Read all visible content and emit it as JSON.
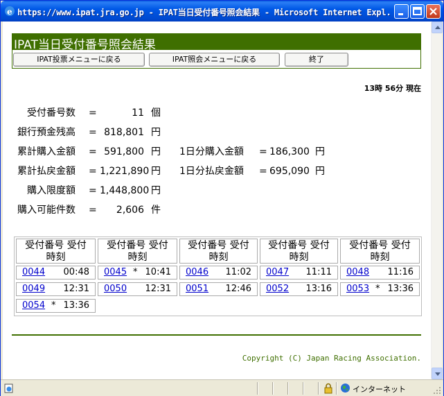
{
  "window": {
    "title": "https://www.ipat.jra.go.jp - IPAT当日受付番号照会結果 - Microsoft Internet Expl..."
  },
  "page": {
    "title": "IPAT当日受付番号照会結果",
    "nav": {
      "vote_menu": "IPAT投票メニューに戻る",
      "inquiry_menu": "IPAT照会メニューに戻る",
      "exit": "終了"
    },
    "current_time": "13時 56分 現在",
    "summary": [
      {
        "label": "受付番号数",
        "eq": "=",
        "value": "11",
        "unit": "個"
      },
      {
        "label": "銀行預金残高",
        "eq": "=",
        "value": "818,801",
        "unit": "円"
      },
      {
        "label": "累計購入金額",
        "eq": "=",
        "value": "591,800",
        "unit": "円",
        "label2": "1日分購入金額",
        "eq2": "=",
        "value2": "186,300",
        "unit2": "円"
      },
      {
        "label": "累計払戻金額",
        "eq": "=",
        "value": "1,221,890",
        "unit": "円",
        "label2": "1日分払戻金額",
        "eq2": "=",
        "value2": "695,090",
        "unit2": "円"
      },
      {
        "label": "購入限度額",
        "eq": "=",
        "value": "1,448,800",
        "unit": "円"
      },
      {
        "label": "購入可能件数",
        "eq": "=",
        "value": "2,606",
        "unit": "件"
      }
    ],
    "table": {
      "headers": [
        {
          "line1": "受付番号 受付",
          "line2": "時刻"
        },
        {
          "line1": "受付番号 受付",
          "line2": "時刻"
        },
        {
          "line1": "受付番号 受付",
          "line2": "時刻"
        },
        {
          "line1": "受付番号 受付",
          "line2": "時刻"
        },
        {
          "line1": "受付番号 受付",
          "line2": "時刻"
        }
      ],
      "rows": [
        [
          {
            "num": "0044",
            "mark": "",
            "time": "00:48"
          },
          {
            "num": "0045",
            "mark": "*",
            "time": "10:41"
          },
          {
            "num": "0046",
            "mark": "",
            "time": "11:02"
          },
          {
            "num": "0047",
            "mark": "",
            "time": "11:11"
          },
          {
            "num": "0048",
            "mark": "",
            "time": "11:16"
          }
        ],
        [
          {
            "num": "0049",
            "mark": "",
            "time": "12:31"
          },
          {
            "num": "0050",
            "mark": "",
            "time": "12:31"
          },
          {
            "num": "0051",
            "mark": "",
            "time": "12:46"
          },
          {
            "num": "0052",
            "mark": "",
            "time": "13:16"
          },
          {
            "num": "0053",
            "mark": "*",
            "time": "13:36"
          }
        ],
        [
          {
            "num": "0054",
            "mark": "*",
            "time": "13:36"
          }
        ]
      ]
    },
    "copyright": "Copyright (C) Japan Racing Association."
  },
  "statusbar": {
    "zone": "インターネット"
  },
  "colors": {
    "header_green": "#3f6f00",
    "link_blue": "#0000cc"
  }
}
